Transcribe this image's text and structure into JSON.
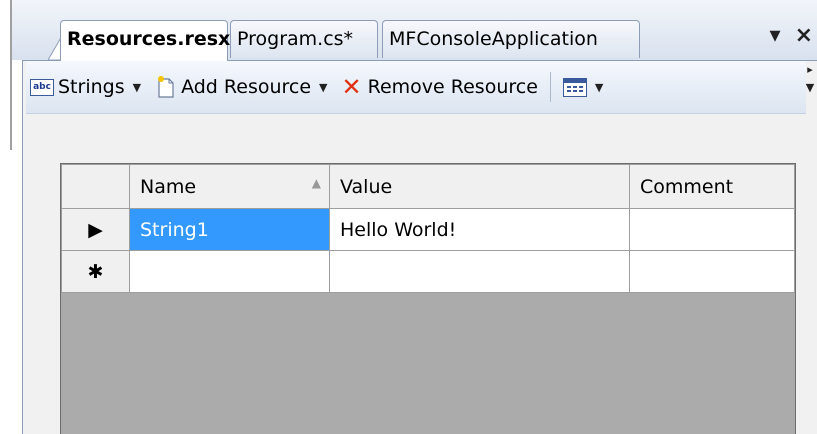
{
  "tabs": [
    {
      "label": "Resources.resx",
      "active": true
    },
    {
      "label": "Program.cs*",
      "active": false
    },
    {
      "label": "MFConsoleApplication",
      "active": false
    }
  ],
  "window_controls": {
    "pin": "▾",
    "close": "×"
  },
  "toolbar": {
    "strings_label": "Strings",
    "strings_icon_text": "abc",
    "add_resource_label": "Add Resource",
    "remove_resource_label": "Remove Resource",
    "dropdown_glyph": "▼",
    "overflow_glyph": "▸"
  },
  "grid": {
    "columns": [
      {
        "label": "Name",
        "sorted": "ascending"
      },
      {
        "label": "Value"
      },
      {
        "label": "Comment"
      }
    ],
    "sort_glyph": "▲",
    "rows": [
      {
        "indicator": "▶",
        "name": "String1",
        "value": "Hello World!",
        "comment": ""
      },
      {
        "indicator": "✱",
        "name": "",
        "value": "",
        "comment": ""
      }
    ]
  },
  "colors": {
    "selection": "#3399ff",
    "remove_icon": "#e03010",
    "grid_background": "#ababab"
  }
}
